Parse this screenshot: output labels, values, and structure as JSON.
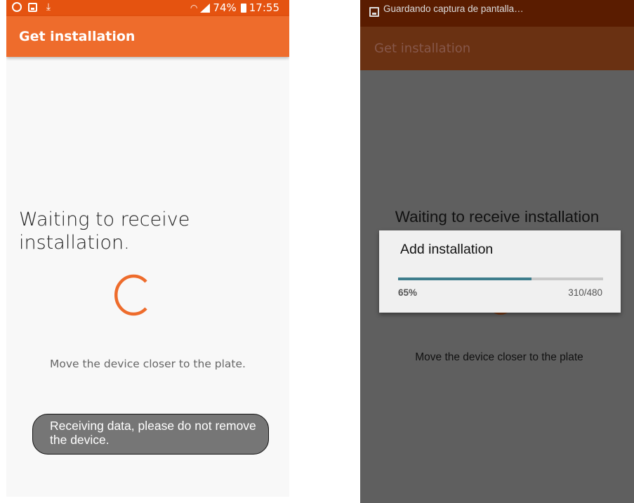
{
  "left": {
    "status_bar": {
      "battery": "74%",
      "time": "17:55"
    },
    "app_bar": {
      "title": "Get installation"
    },
    "waiting_message": "Waiting to receive installation.",
    "hint": "Move the device closer to the plate.",
    "toast": "Receiving data, please do not remove the device.",
    "accent_color": "#ee6c2c",
    "icons": [
      "whatsapp-icon",
      "image-icon",
      "download-icon",
      "wifi-icon",
      "signal-icon",
      "battery-icon",
      "spinner-icon"
    ]
  },
  "right": {
    "status_bar": {
      "notification": "Guardando captura de pantalla…"
    },
    "app_bar": {
      "title": "Get installation"
    },
    "waiting_message": "Waiting to receive installation",
    "dialog": {
      "title": "Add installation",
      "progress_percent": 65,
      "progress_label": "65%",
      "progress_count": "310/480",
      "progress_color": "#3e7d8c"
    },
    "hint": "Move the device closer to the plate"
  }
}
